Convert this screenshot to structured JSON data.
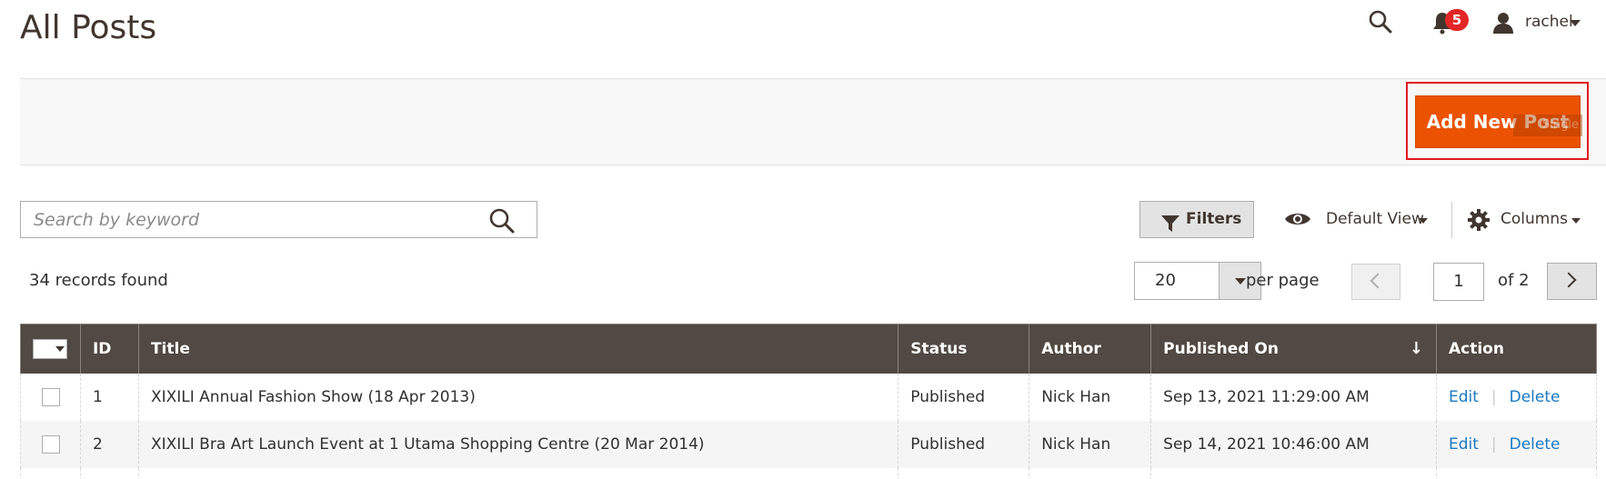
{
  "page": {
    "title": "All Posts"
  },
  "header": {
    "notifications_count": "5",
    "user_name": "rachel"
  },
  "action_bar": {
    "add_button_label": "Add New Post",
    "overlay_label": "Single"
  },
  "toolbar": {
    "search_placeholder": "Search by keyword",
    "filters_label": "Filters",
    "view_label": "Default View",
    "columns_label": "Columns"
  },
  "summary": {
    "records_found": "34 records found",
    "per_page_value": "20",
    "per_page_label": "per page",
    "current_page": "1",
    "total_pages_label": "of 2"
  },
  "grid": {
    "columns": [
      "ID",
      "Title",
      "Status",
      "Author",
      "Published On",
      "Action"
    ],
    "sort_indicator": "↓",
    "action_edit": "Edit",
    "action_separator": "|",
    "action_delete": "Delete",
    "rows": [
      {
        "id": "1",
        "title": "XIXILI Annual Fashion Show (18 Apr 2013)",
        "status": "Published",
        "author": "Nick Han",
        "published_on": "Sep 13, 2021 11:29:00 AM"
      },
      {
        "id": "2",
        "title": "XIXILI Bra Art Launch Event at 1 Utama Shopping Centre (20 Mar 2014)",
        "status": "Published",
        "author": "Nick Han",
        "published_on": "Sep 14, 2021 10:46:00 AM"
      }
    ]
  },
  "colors": {
    "primary_button": "#eb5202",
    "grid_header": "#514943",
    "link": "#1979c3",
    "badge": "#e22626",
    "highlight": "#e0191f"
  }
}
